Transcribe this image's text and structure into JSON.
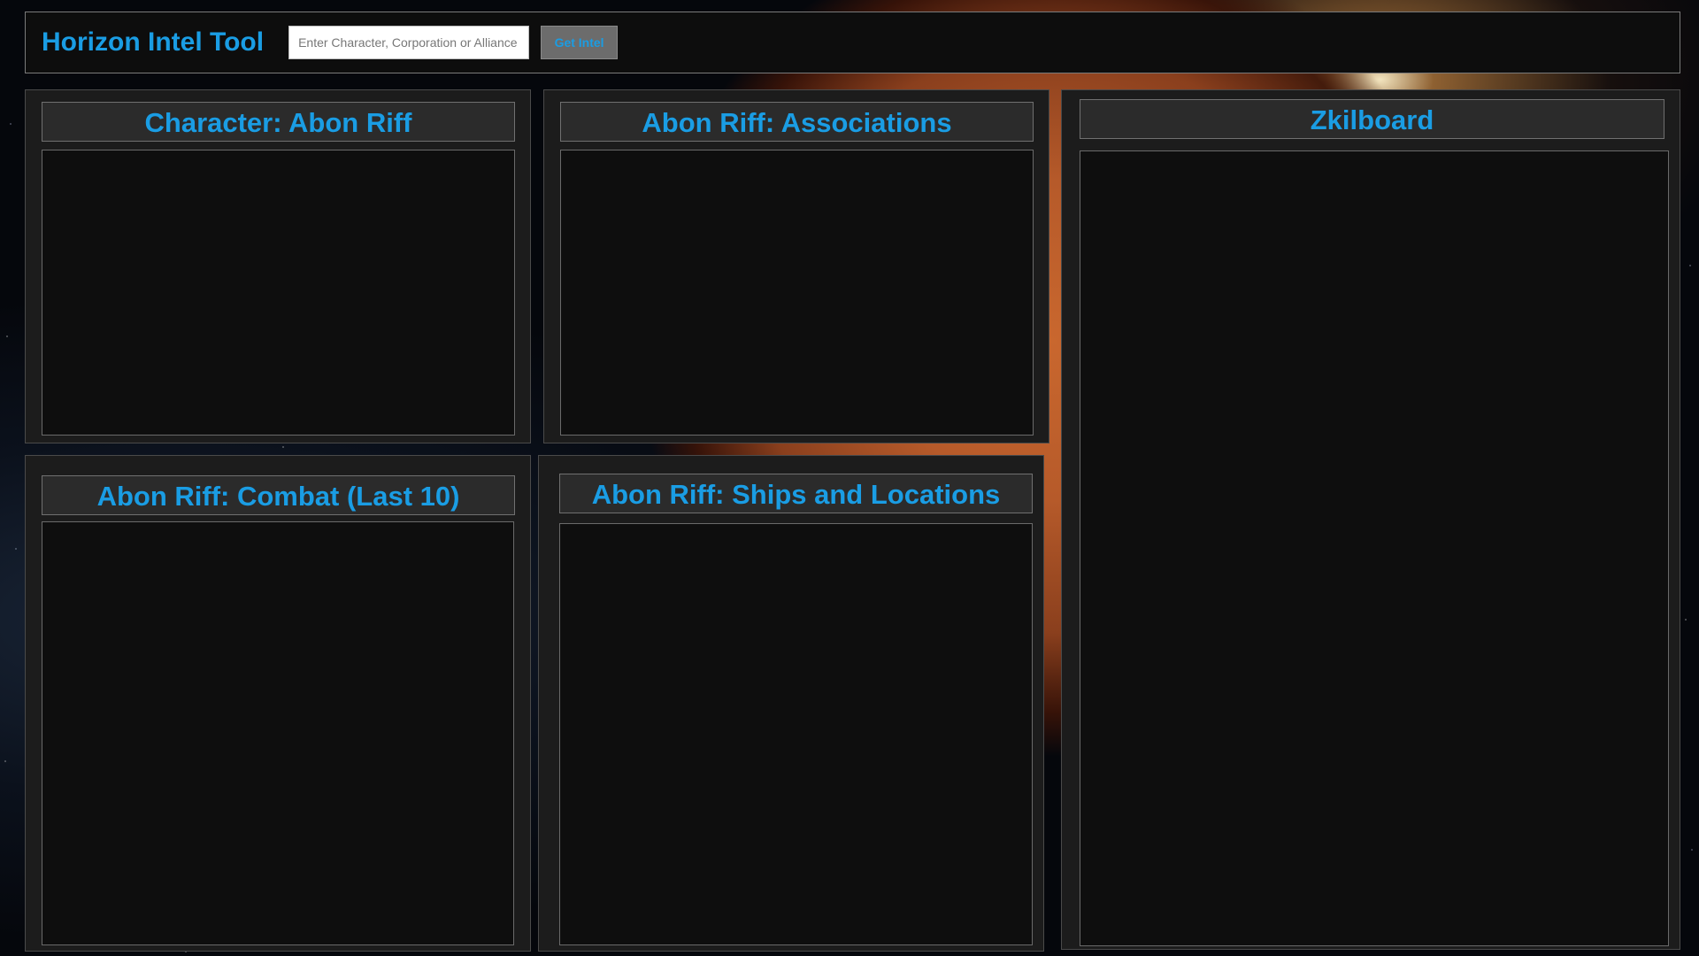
{
  "header": {
    "app_title": "Horizon Intel Tool",
    "search_placeholder": "Enter Character, Corporation or Alliance",
    "search_value": "",
    "get_intel_label": "Get Intel"
  },
  "panels": {
    "character": {
      "title": "Character: Abon Riff"
    },
    "associations": {
      "title": "Abon Riff: Associations"
    },
    "zkillboard": {
      "title": "Zkilboard"
    },
    "combat": {
      "title": "Abon Riff: Combat (Last 10)"
    },
    "ships": {
      "title": "Abon Riff: Ships and Locations"
    }
  },
  "colors": {
    "accent": "#1a9de4",
    "panel_bg": "#1c1c1c",
    "panel_body_bg": "#0e0e0e",
    "button_bg": "#6c6c6c"
  }
}
